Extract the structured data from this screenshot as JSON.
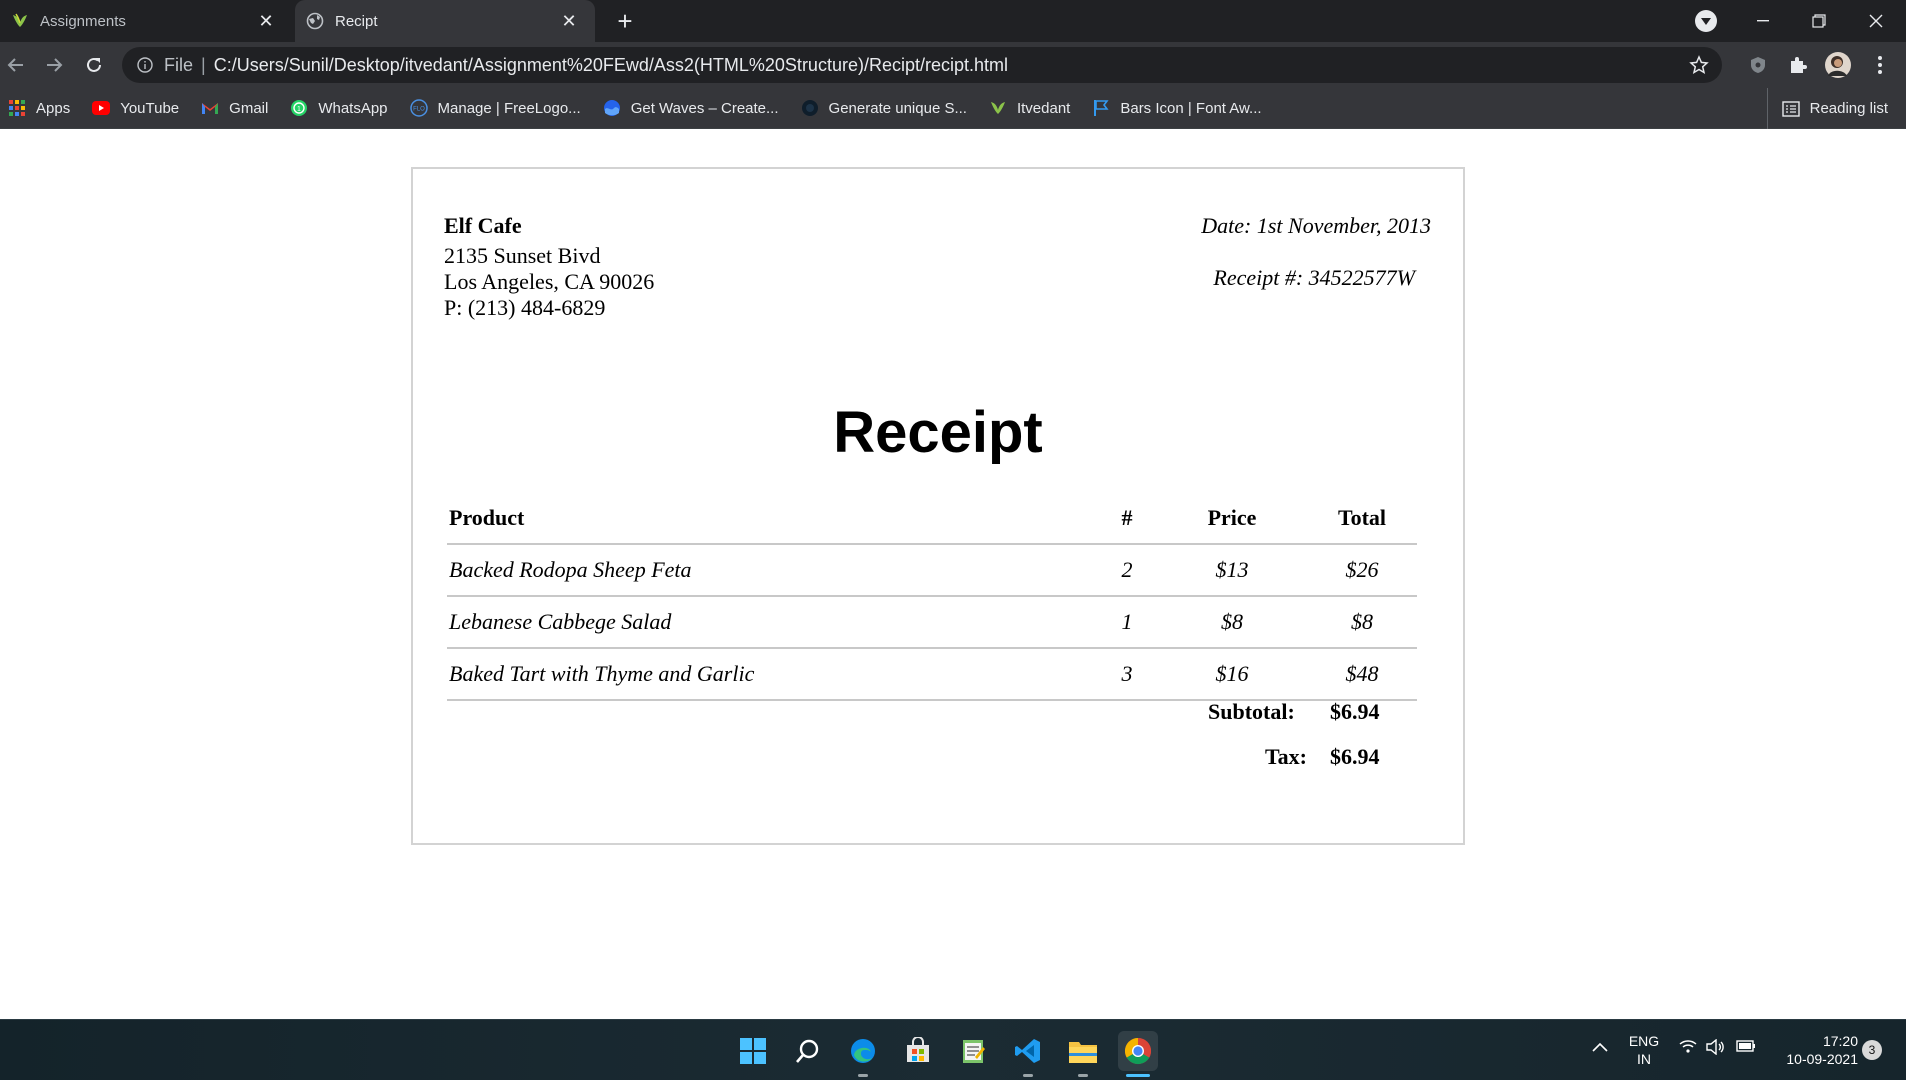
{
  "browser": {
    "tabs": [
      {
        "title": "Assignments",
        "icon": "itvedant-leaf-icon",
        "active": false
      },
      {
        "title": "Recipt",
        "icon": "globe-icon",
        "active": true
      }
    ],
    "address": {
      "scheme_label": "File",
      "url": "C:/Users/Sunil/Desktop/itvedant/Assignment%20FEwd/Ass2(HTML%20Structure)/Recipt/recipt.html"
    },
    "bookmarks": [
      {
        "label": "Apps",
        "icon": "apps-grid-icon"
      },
      {
        "label": "YouTube",
        "icon": "youtube-icon"
      },
      {
        "label": "Gmail",
        "icon": "gmail-icon"
      },
      {
        "label": "WhatsApp",
        "icon": "whatsapp-icon"
      },
      {
        "label": "Manage | FreeLogo...",
        "icon": "freelogo-icon"
      },
      {
        "label": "Get Waves – Create...",
        "icon": "waves-icon"
      },
      {
        "label": "Generate unique S...",
        "icon": "dark-circle-icon"
      },
      {
        "label": "Itvedant",
        "icon": "itvedant-leaf-icon"
      },
      {
        "label": "Bars Icon | Font Aw...",
        "icon": "flag-icon"
      }
    ],
    "reading_list": "Reading list"
  },
  "receipt": {
    "company": {
      "name": "Elf Cafe",
      "address1": "2135 Sunset Bivd",
      "address2": "Los Angeles, CA 90026",
      "phone": "P: (213) 484-6829"
    },
    "date": "Date: 1st November, 2013",
    "receipt_no": "Receipt #: 34522577W",
    "heading": "Receipt",
    "columns": [
      "Product",
      "#",
      "Price",
      "Total"
    ],
    "items": [
      {
        "product": "Backed Rodopa Sheep Feta",
        "qty": "2",
        "price": "$13",
        "total": "$26"
      },
      {
        "product": "Lebanese Cabbege Salad",
        "qty": "1",
        "price": "$8",
        "total": "$8"
      },
      {
        "product": "Baked Tart with Thyme and Garlic",
        "qty": "3",
        "price": "$16",
        "total": "$48"
      }
    ],
    "subtotal_label": "Subtotal:",
    "subtotal_value": "$6.94",
    "tax_label": "Tax:",
    "tax_value": "$6.94"
  },
  "taskbar": {
    "apps": [
      "windows-start-icon",
      "search-icon",
      "edge-icon",
      "store-icon",
      "notepad-icon",
      "vscode-icon",
      "file-explorer-icon",
      "chrome-icon"
    ],
    "language": "ENG",
    "region": "IN",
    "time": "17:20",
    "date": "10-09-2021",
    "notification_count": "3"
  }
}
